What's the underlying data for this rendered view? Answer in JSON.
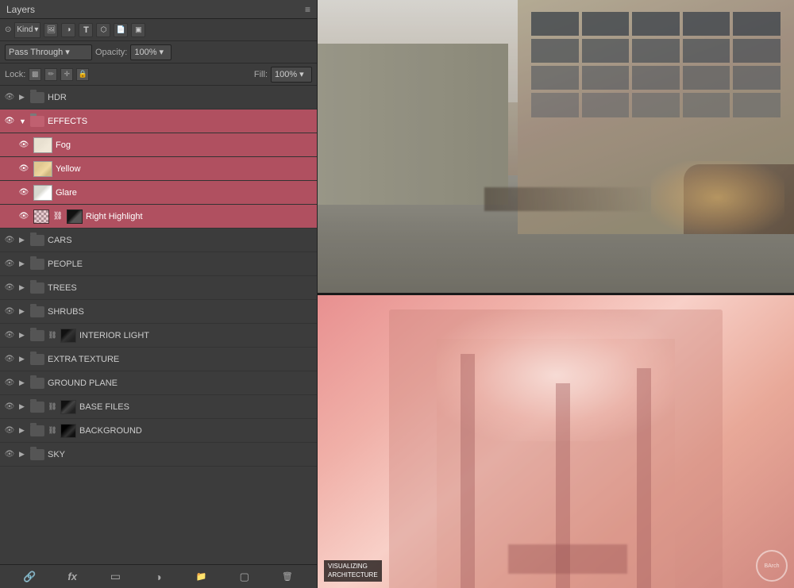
{
  "panel": {
    "title": "Layers",
    "filter_label": "Kind",
    "blend_mode": "Pass Through",
    "opacity_label": "Opacity:",
    "opacity_value": "100%",
    "lock_label": "Lock:",
    "fill_label": "Fill:",
    "fill_value": "100%"
  },
  "layers": [
    {
      "id": "hdr",
      "name": "HDR",
      "type": "group",
      "visible": true,
      "expanded": false,
      "selected": false,
      "indent": 0
    },
    {
      "id": "effects",
      "name": "EFFECTS",
      "type": "group",
      "visible": true,
      "expanded": true,
      "selected": false,
      "indent": 0,
      "group_selected": true
    },
    {
      "id": "fog",
      "name": "Fog",
      "type": "layer",
      "visible": true,
      "selected": false,
      "indent": 1,
      "thumb": "fog",
      "group_selected": true
    },
    {
      "id": "yellow",
      "name": "Yellow",
      "type": "layer",
      "visible": true,
      "selected": false,
      "indent": 1,
      "thumb": "yellow",
      "group_selected": true
    },
    {
      "id": "glare",
      "name": "Glare",
      "type": "layer",
      "visible": true,
      "selected": false,
      "indent": 1,
      "thumb": "glare",
      "group_selected": true
    },
    {
      "id": "right_highlight",
      "name": "Right Highlight",
      "type": "layer",
      "visible": true,
      "selected": true,
      "indent": 1,
      "thumb": "rh",
      "group_selected": true,
      "has_chain": true,
      "has_extra_thumb": true
    },
    {
      "id": "cars",
      "name": "CARS",
      "type": "group",
      "visible": true,
      "expanded": false,
      "selected": false,
      "indent": 0
    },
    {
      "id": "people",
      "name": "PEOPLE",
      "type": "group",
      "visible": true,
      "expanded": false,
      "selected": false,
      "indent": 0
    },
    {
      "id": "trees",
      "name": "TREES",
      "type": "group",
      "visible": true,
      "expanded": false,
      "selected": false,
      "indent": 0
    },
    {
      "id": "shrubs",
      "name": "SHRUBS",
      "type": "group",
      "visible": true,
      "expanded": false,
      "selected": false,
      "indent": 0
    },
    {
      "id": "interior_light",
      "name": "INTERIOR LIGHT",
      "type": "group",
      "visible": true,
      "expanded": false,
      "selected": false,
      "indent": 0,
      "has_chain": true,
      "has_extra_thumb": true
    },
    {
      "id": "extra_texture",
      "name": "EXTRA TEXTURE",
      "type": "group",
      "visible": true,
      "expanded": false,
      "selected": false,
      "indent": 0
    },
    {
      "id": "ground_plane",
      "name": "GROUND PLANE",
      "type": "group",
      "visible": true,
      "expanded": false,
      "selected": false,
      "indent": 0
    },
    {
      "id": "base_files",
      "name": "BASE FILES",
      "type": "group",
      "visible": true,
      "expanded": false,
      "selected": false,
      "indent": 0,
      "has_chain": true,
      "has_extra_thumb": true
    },
    {
      "id": "background",
      "name": "BACKGROUND",
      "type": "group",
      "visible": true,
      "expanded": false,
      "selected": false,
      "indent": 0,
      "has_chain": true,
      "has_extra_thumb": true
    },
    {
      "id": "sky",
      "name": "SKY",
      "type": "group",
      "visible": true,
      "expanded": false,
      "selected": false,
      "indent": 0
    }
  ],
  "bottom_toolbar": {
    "link_icon": "🔗",
    "fx_icon": "fx",
    "mask_icon": "▭",
    "adj_icon": "◑",
    "folder_icon": "📁",
    "new_icon": "▢",
    "delete_icon": "🗑"
  },
  "canvas": {
    "watermark_text": "VISUALIZING\nARCHITECTURE",
    "watermark_logo": "BArch"
  }
}
